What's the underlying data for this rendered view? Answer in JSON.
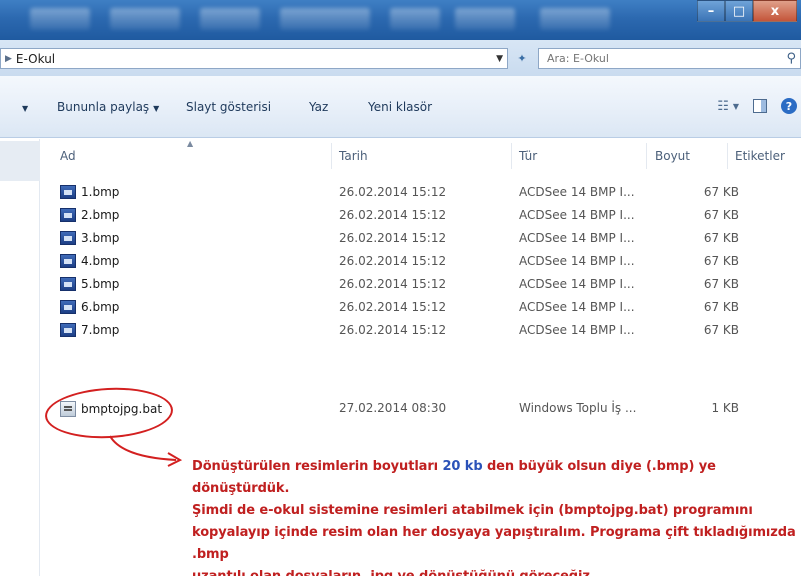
{
  "address": {
    "path": "E-Okul",
    "search_placeholder": "Ara: E-Okul"
  },
  "toolbar": {
    "share_label": "Bununla paylaş",
    "slideshow_label": "Slayt gösterisi",
    "print_label": "Yaz",
    "new_folder_label": "Yeni klasör"
  },
  "columns": {
    "name": "Ad",
    "date": "Tarih",
    "type": "Tür",
    "size": "Boyut",
    "tags": "Etiketler"
  },
  "files": [
    {
      "name": "1.bmp",
      "date": "26.02.2014 15:12",
      "type": "ACDSee 14 BMP I...",
      "size": "67 KB",
      "icon": "bmp-file-icon"
    },
    {
      "name": "2.bmp",
      "date": "26.02.2014 15:12",
      "type": "ACDSee 14 BMP I...",
      "size": "67 KB",
      "icon": "bmp-file-icon"
    },
    {
      "name": "3.bmp",
      "date": "26.02.2014 15:12",
      "type": "ACDSee 14 BMP I...",
      "size": "67 KB",
      "icon": "bmp-file-icon"
    },
    {
      "name": "4.bmp",
      "date": "26.02.2014 15:12",
      "type": "ACDSee 14 BMP I...",
      "size": "67 KB",
      "icon": "bmp-file-icon"
    },
    {
      "name": "5.bmp",
      "date": "26.02.2014 15:12",
      "type": "ACDSee 14 BMP I...",
      "size": "67 KB",
      "icon": "bmp-file-icon"
    },
    {
      "name": "6.bmp",
      "date": "26.02.2014 15:12",
      "type": "ACDSee 14 BMP I...",
      "size": "67 KB",
      "icon": "bmp-file-icon"
    },
    {
      "name": "7.bmp",
      "date": "26.02.2014 15:12",
      "type": "ACDSee 14 BMP I...",
      "size": "67 KB",
      "icon": "bmp-file-icon"
    },
    {
      "name": "bmptojpg.bat",
      "date": "27.02.2014 08:30",
      "type": "Windows Toplu İş ...",
      "size": "1 KB",
      "icon": "batch-file-icon"
    }
  ],
  "annotation": {
    "part1": "Dönüştürülen resimlerin boyutları ",
    "highlight1": "20 kb",
    "part2": " den büyük olsun diye ",
    "highlight2": "(.bmp)",
    "part3": " ye dönüştürdük.",
    "line2": "Şimdi de e-okul sistemine resimleri atabilmek için (bmptojpg.bat) programını",
    "line3": "kopyalayıp içinde resim olan her dosyaya yapıştıralım. Programa çift tıkladığımızda .bmp",
    "line4": "uzantılı olan dosyaların .jpg ye dönüştüğünü göreceğiz."
  },
  "colors": {
    "annotation_red": "#c02020",
    "highlight_blue": "#2b52b8",
    "titlebar_blue": "#2c69b0"
  }
}
